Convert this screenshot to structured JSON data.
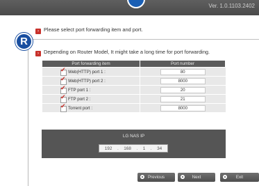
{
  "header": {
    "version": "Ver. 1.0.1103.2402"
  },
  "badge": "R",
  "instructions": {
    "select": "Please select port forwarding item and port.",
    "note": "Depending on Router Model, It might take a long time for port forwarding."
  },
  "table": {
    "headers": [
      "Port forwarding item",
      "Port number"
    ],
    "rows": [
      {
        "label": "Web(HTTP) port 1 :",
        "port": "80",
        "checked": true
      },
      {
        "label": "Web(HTTP) port 2 :",
        "port": "8000",
        "checked": true
      },
      {
        "label": "FTP port 1 :",
        "port": "20",
        "checked": true
      },
      {
        "label": "FTP port 2 :",
        "port": "21",
        "checked": true
      },
      {
        "label": "Torrent port :",
        "port": "8000",
        "checked": true
      }
    ]
  },
  "nas": {
    "title": "LG NAS IP",
    "ip": [
      "192",
      "168",
      "1",
      "34"
    ],
    "separator": "."
  },
  "buttons": {
    "previous": "Previous",
    "next": "Next",
    "exit": "Exit"
  },
  "colors": {
    "accent_red": "#c8312b",
    "badge_blue": "#1a4fa0",
    "header_gray": "#5b5b5b"
  }
}
